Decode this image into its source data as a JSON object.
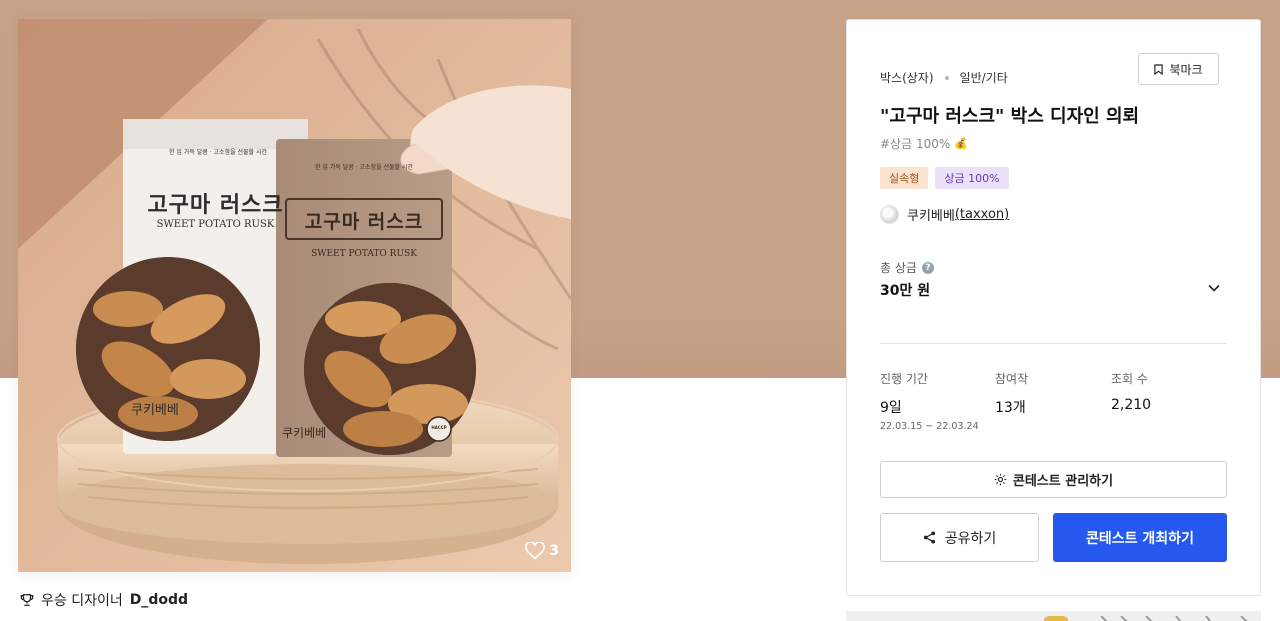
{
  "product": {
    "image_alt": "고구마 러스크 박스 디자인",
    "likes": "3",
    "box_left": {
      "title": "고구마 러스크",
      "subtitle": "SWEET POTATO RUSK",
      "brand": "쿠키베베",
      "tagline": "한 입 가득 달콤 · 고소함을 선물할 시간"
    },
    "box_right": {
      "title": "고구마 러스크",
      "subtitle": "SWEET POTATO RUSK",
      "brand": "쿠키베베",
      "tagline": "한 입 가득 달콤 · 고소함을 선물할 시간",
      "seal": "HACCP"
    }
  },
  "winner": {
    "label": "우승 디자이너",
    "name": "D_dodd"
  },
  "contest": {
    "category": "박스(상자)",
    "subcategory": "일반/기타",
    "bookmark_label": "북마크",
    "title": "\"고구마 러스크\" 박스 디자인 의뢰",
    "tagline": "#상금 100%",
    "badges": [
      "실속형",
      "상금 100%"
    ],
    "host_name": "쿠키베베",
    "host_id": "(taxxon)",
    "prize_label": "총 상금",
    "prize_value": "30만 원",
    "stats": [
      {
        "label": "진행 기간",
        "value": "9일",
        "sub": "22.03.15 ~ 22.03.24"
      },
      {
        "label": "참여작",
        "value": "13개"
      },
      {
        "label": "조회 수",
        "value": "2,210"
      }
    ],
    "manage_label": "콘테스트 관리하기",
    "share_label": "공유하기",
    "host_label": "콘테스트 개최하기"
  },
  "colors": {
    "hero": "#c7a287",
    "primary": "#2458ee"
  }
}
